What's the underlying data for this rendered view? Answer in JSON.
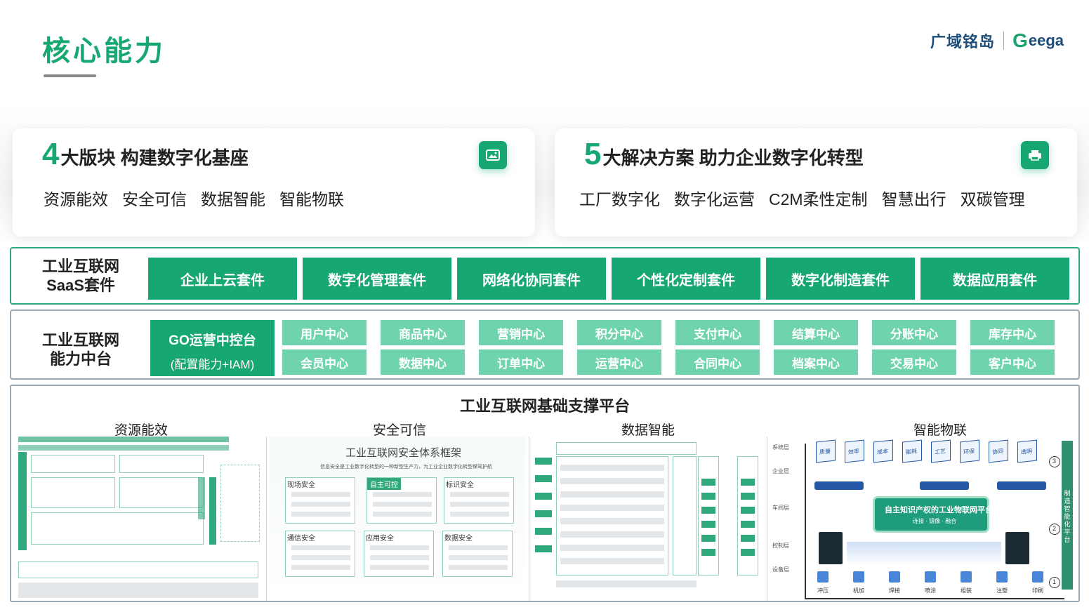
{
  "page": {
    "title": "核心能力"
  },
  "brand": {
    "name_cn": "广域铭岛",
    "logo_text": "eega",
    "logo_initial": "G"
  },
  "cards": [
    {
      "number": "4",
      "heading": "大版块 构建数字化基座",
      "items": [
        "资源能效",
        "安全可信",
        "数据智能",
        "智能物联"
      ],
      "icon": "image-icon"
    },
    {
      "number": "5",
      "heading": "大解决方案 助力企业数字化转型",
      "items": [
        "工厂数字化",
        "数字化运营",
        "C2M柔性定制",
        "智慧出行",
        "双碳管理"
      ],
      "icon": "printer-icon"
    }
  ],
  "saas": {
    "label_line1": "工业互联网",
    "label_line2": "SaaS套件",
    "suites": [
      "企业上云套件",
      "数字化管理套件",
      "网络化协同套件",
      "个性化定制套件",
      "数字化制造套件",
      "数据应用套件"
    ]
  },
  "capability": {
    "label_line1": "工业互联网",
    "label_line2": "能力中台",
    "go_title": "GO运营中控台",
    "go_subtitle": "(配置能力+IAM)",
    "top_row": [
      "用户中心",
      "商品中心",
      "营销中心",
      "积分中心",
      "支付中心",
      "结算中心",
      "分账中心",
      "库存中心"
    ],
    "bottom_row": [
      "会员中心",
      "数据中心",
      "订单中心",
      "运营中心",
      "合同中心",
      "档案中心",
      "交易中心",
      "客户中心"
    ]
  },
  "foundation": {
    "title": "工业互联网基础支撑平台",
    "columns": [
      "资源能效",
      "安全可信",
      "数据智能",
      "智能物联"
    ],
    "security": {
      "title": "工业互联网安全体系框架",
      "subtitle": "信息安全是工业数字化转型的一种新型生产力，为工业企业数字化转型保驾护航",
      "blocks": [
        "现场安全",
        "自主可控",
        "标识安全",
        "通信安全",
        "应用安全",
        "数据安全"
      ]
    },
    "iot": {
      "layers": [
        "系统层",
        "企业层",
        "车间层",
        "控制层",
        "设备层"
      ],
      "tags": [
        "质量",
        "效率",
        "成本",
        "能耗",
        "工艺",
        "环保",
        "协同",
        "透明"
      ],
      "platform_title": "自主知识产权的工业物联网平台",
      "platform_sub": "连接 · 镜像 · 融合",
      "side_label": "制造智能化平台",
      "steps": [
        "1",
        "2",
        "3"
      ],
      "processes": [
        "冲压",
        "机加",
        "焊接",
        "喷涂",
        "组装",
        "注塑",
        "印刷"
      ]
    }
  }
}
